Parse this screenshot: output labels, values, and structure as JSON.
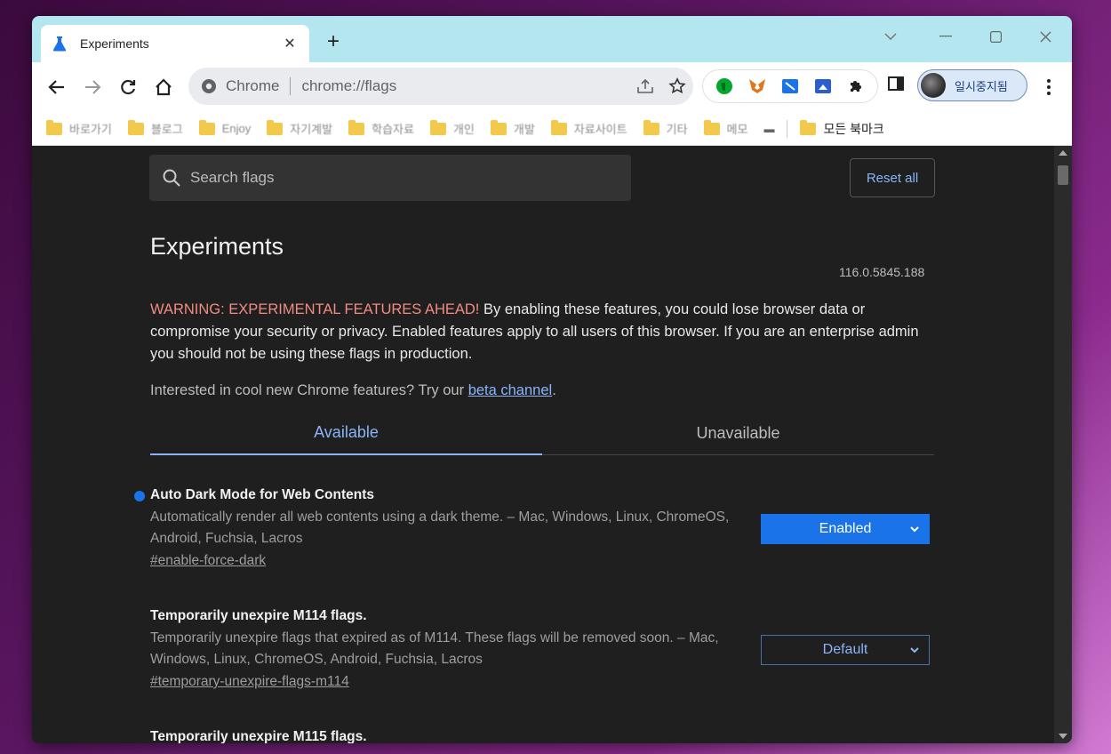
{
  "tab": {
    "title": "Experiments"
  },
  "omnibox": {
    "scheme_label": "Chrome",
    "url": "chrome://flags"
  },
  "profile": {
    "label": "일시중지됨"
  },
  "bookmarks": [
    {
      "label": "바로가기"
    },
    {
      "label": "블로그"
    },
    {
      "label": "Enjoy"
    },
    {
      "label": "자기계발"
    },
    {
      "label": "학습자료"
    },
    {
      "label": "개인"
    },
    {
      "label": "개발"
    },
    {
      "label": "자료사이트"
    },
    {
      "label": "기타"
    },
    {
      "label": "메모"
    },
    {
      "label": "모든 북마크"
    }
  ],
  "page": {
    "search_placeholder": "Search flags",
    "reset_label": "Reset all",
    "title": "Experiments",
    "version": "116.0.5845.188",
    "warning_prefix": "WARNING: EXPERIMENTAL FEATURES AHEAD!",
    "warning_body": " By enabling these features, you could lose browser data or compromise your security or privacy. Enabled features apply to all users of this browser. If you are an enterprise admin you should not be using these flags in production.",
    "interest_text": "Interested in cool new Chrome features? Try our ",
    "interest_link": "beta channel",
    "interest_end": ".",
    "tabs": [
      {
        "label": "Available"
      },
      {
        "label": "Unavailable"
      }
    ],
    "flags": [
      {
        "title": "Auto Dark Mode for Web Contents",
        "description": "Automatically render all web contents using a dark theme. – Mac, Windows, Linux, ChromeOS, Android, Fuchsia, Lacros",
        "anchor": "#enable-force-dark",
        "value": "Enabled"
      },
      {
        "title": "Temporarily unexpire M114 flags.",
        "description": "Temporarily unexpire flags that expired as of M114. These flags will be removed soon. – Mac, Windows, Linux, ChromeOS, Android, Fuchsia, Lacros",
        "anchor": "#temporary-unexpire-flags-m114",
        "value": "Default"
      },
      {
        "title": "Temporarily unexpire M115 flags."
      }
    ]
  },
  "colors": {
    "accent": "#8ab4f8",
    "enabled_bg": "#1a73e8",
    "warning": "#f28b82",
    "tabstrip": "#b4e6f0"
  }
}
